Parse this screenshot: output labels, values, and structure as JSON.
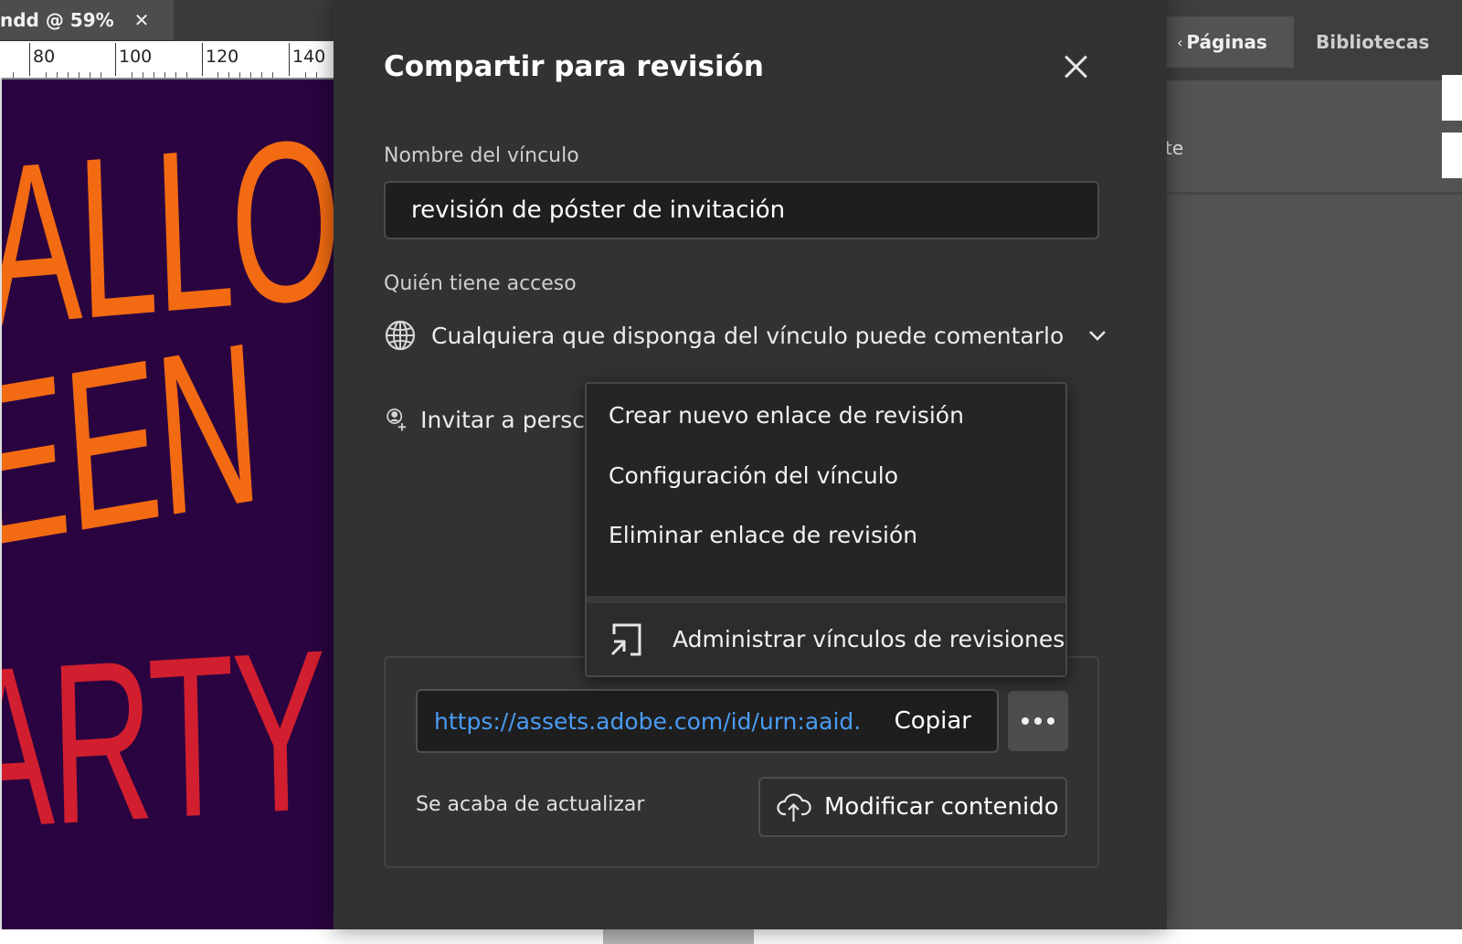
{
  "document": {
    "tab_title": "ndd @ 59%",
    "ruler_numbers": [
      "80",
      "100",
      "120",
      "140"
    ],
    "canvas_words": [
      "ALLO",
      "EEN",
      "ARTY"
    ],
    "colors": {
      "canvas_bg": "#2a0440",
      "orange": "#f26b12",
      "red": "#d11f2f"
    }
  },
  "panel": {
    "tabs": [
      {
        "label": "Páginas",
        "active": true
      },
      {
        "label": "Bibliotecas",
        "active": false
      }
    ],
    "partial_text": "te"
  },
  "dialog": {
    "title": "Compartir para revisión",
    "link_name_label": "Nombre del vínculo",
    "link_name_value": "revisión de póster de invitación",
    "access_label": "Quién tiene acceso",
    "access_value": "Cualquiera que disponga del vínculo puede comentarlo",
    "invite_label": "Invitar a persc",
    "url": "https://assets.adobe.com/id/urn:aaid...",
    "copy_label": "Copiar",
    "updated_text": "Se acaba de actualizar",
    "modify_label": "Modificar contenido",
    "colors": {
      "link": "#4a9cf5",
      "bg": "#323232"
    }
  },
  "menu": {
    "items": [
      "Crear nuevo enlace de revisión",
      "Configuración del vínculo",
      "Eliminar enlace de revisión"
    ],
    "footer_label": "Administrar vínculos de revisiones"
  }
}
